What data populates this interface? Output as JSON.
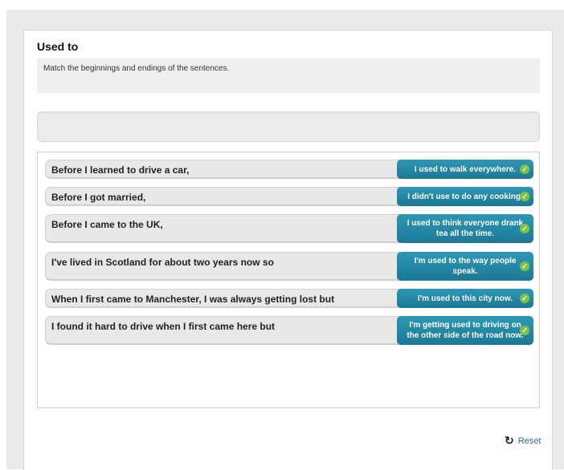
{
  "activity": {
    "title": "Used to",
    "instructions": "Match the beginnings and endings of the sentences."
  },
  "rows": [
    {
      "beginning": "Before I learned to drive a car,",
      "ending": "I used to walk everywhere.",
      "correct": true
    },
    {
      "beginning": "Before I got married,",
      "ending": "I didn't use to do any cooking.",
      "correct": true
    },
    {
      "beginning": "Before I came to the UK,",
      "ending": "I used to think everyone drank tea all the time.",
      "correct": true
    },
    {
      "beginning": "I've lived in Scotland for about two years now so",
      "ending": "I'm used to the way people speak.",
      "correct": true
    },
    {
      "beginning": "When I first came to Manchester, I was always getting lost but",
      "ending": "I'm used to this city now.",
      "correct": true
    },
    {
      "beginning": "I found it hard to drive when I first came here but",
      "ending": "I'm getting used to driving on the other side of the road now.",
      "correct": true
    }
  ],
  "controls": {
    "reset_label": "Reset",
    "reset_icon": "reset-icon",
    "check_icon": "check-icon"
  },
  "colors": {
    "answer_bg": "#1f86a4",
    "check_green": "#7cc243",
    "reset_link": "#2c6e99"
  }
}
